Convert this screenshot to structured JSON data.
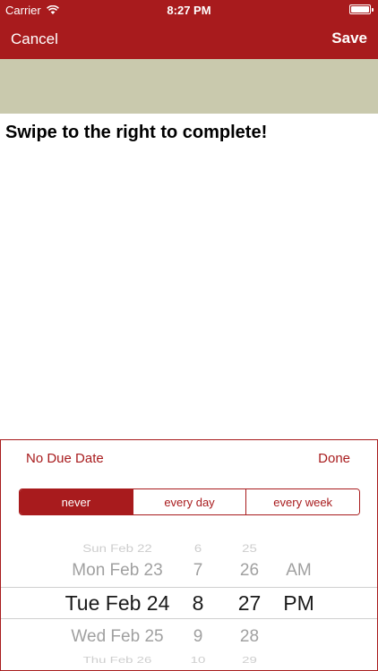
{
  "status_bar": {
    "carrier": "Carrier",
    "time": "8:27 PM"
  },
  "nav": {
    "cancel_label": "Cancel",
    "save_label": "Save"
  },
  "task": {
    "title": "Swipe to the right to complete!"
  },
  "due_sheet": {
    "no_due_label": "No Due Date",
    "done_label": "Done",
    "repeat_options": [
      "never",
      "every day",
      "every week"
    ],
    "selected_repeat": "never"
  },
  "picker": {
    "rows": [
      {
        "date": "Sun Feb 22",
        "hour": "6",
        "minute": "25",
        "ampm": ""
      },
      {
        "date": "Mon Feb 23",
        "hour": "7",
        "minute": "26",
        "ampm": "AM"
      },
      {
        "date": "Tue Feb 24",
        "hour": "8",
        "minute": "27",
        "ampm": "PM"
      },
      {
        "date": "Wed Feb 25",
        "hour": "9",
        "minute": "28",
        "ampm": ""
      },
      {
        "date": "Thu Feb 26",
        "hour": "10",
        "minute": "29",
        "ampm": ""
      }
    ]
  },
  "colors": {
    "accent": "#a81b1d",
    "banner": "#c9c9ad"
  }
}
